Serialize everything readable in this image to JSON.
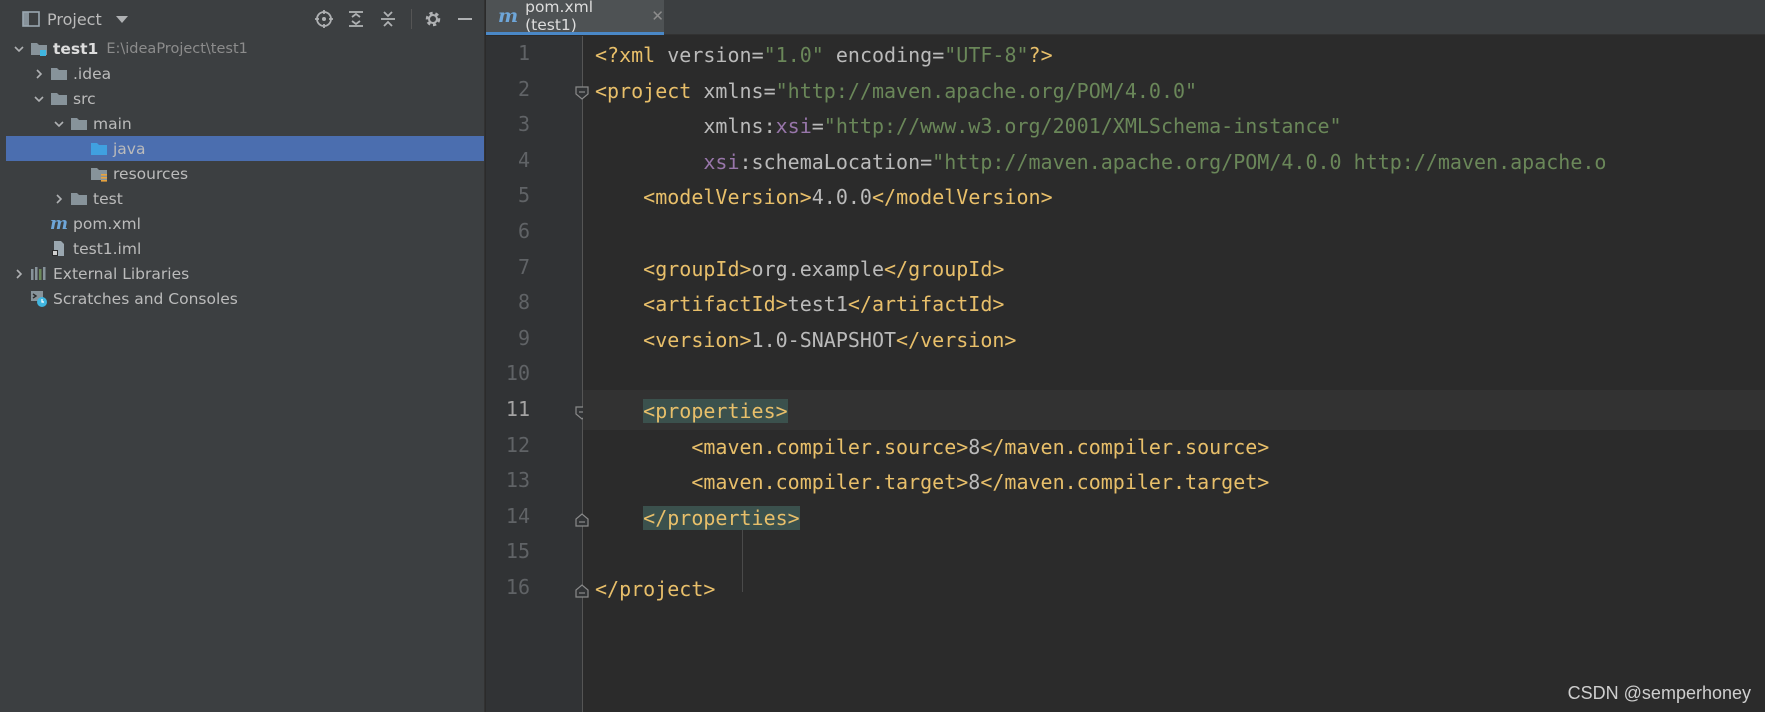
{
  "panel": {
    "title": "Project",
    "tree": [
      {
        "label": "test1",
        "path": "E:\\ideaProject\\test1",
        "level": 0,
        "expanded": true,
        "icon": "module-folder-icon"
      },
      {
        "label": ".idea",
        "level": 1,
        "expanded": false,
        "icon": "folder-icon"
      },
      {
        "label": "src",
        "level": 1,
        "expanded": true,
        "icon": "folder-icon"
      },
      {
        "label": "main",
        "level": 2,
        "expanded": true,
        "icon": "folder-icon"
      },
      {
        "label": "java",
        "level": 3,
        "icon": "source-folder-icon",
        "selected": true
      },
      {
        "label": "resources",
        "level": 3,
        "icon": "resources-folder-icon"
      },
      {
        "label": "test",
        "level": 2,
        "expanded": false,
        "icon": "folder-icon"
      },
      {
        "label": "pom.xml",
        "level": 1,
        "icon": "maven-icon"
      },
      {
        "label": "test1.iml",
        "level": 1,
        "icon": "iml-file-icon"
      },
      {
        "label": "External Libraries",
        "level": 0,
        "expanded": false,
        "icon": "libraries-icon"
      },
      {
        "label": "Scratches and Consoles",
        "level": 0,
        "icon": "scratches-icon"
      }
    ]
  },
  "editor": {
    "tab_label": "pom.xml (test1)",
    "caret_line": 11,
    "lines": [
      "<?xml version=\"1.0\" encoding=\"UTF-8\"?>",
      "<project xmlns=\"http://maven.apache.org/POM/4.0.0\"",
      "         xmlns:xsi=\"http://www.w3.org/2001/XMLSchema-instance\"",
      "         xsi:schemaLocation=\"http://maven.apache.org/POM/4.0.0 http://maven.apache.o",
      "    <modelVersion>4.0.0</modelVersion>",
      "",
      "    <groupId>org.example</groupId>",
      "    <artifactId>test1</artifactId>",
      "    <version>1.0-SNAPSHOT</version>",
      "",
      "    <properties>",
      "        <maven.compiler.source>8</maven.compiler.source>",
      "        <maven.compiler.target>8</maven.compiler.target>",
      "    </properties>",
      "",
      "</project>"
    ]
  },
  "watermark": "CSDN @semperhoney",
  "colors": {
    "panel_bg": "#3c3f41",
    "editor_bg": "#2b2b2b",
    "selection": "#4b6eaf",
    "tag": "#e8bf6a",
    "attr_value": "#6a8759",
    "namespace": "#9876aa",
    "tag_highlight": "#3b514d"
  }
}
